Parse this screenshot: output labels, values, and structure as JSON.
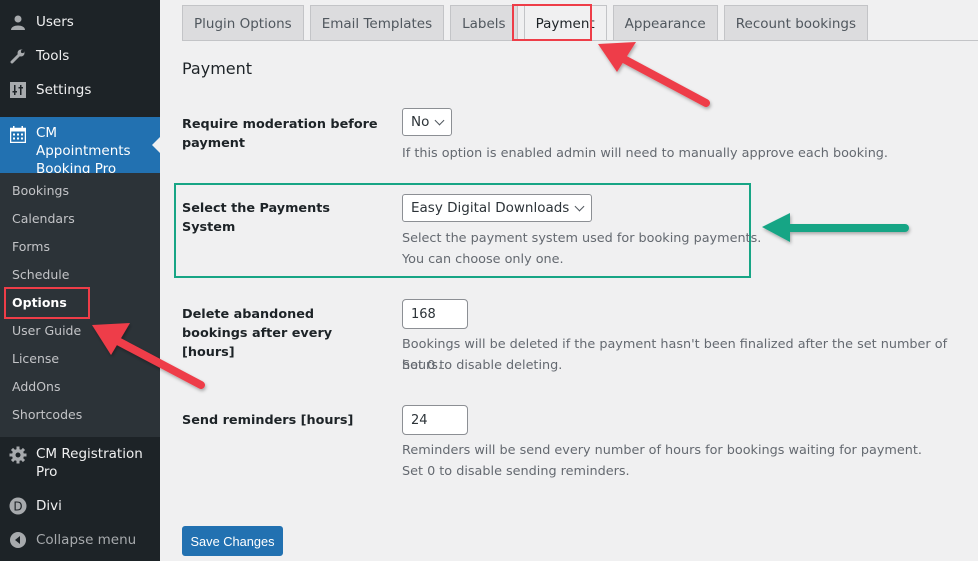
{
  "sidebar": {
    "top_items": [
      {
        "label": "Users",
        "icon": "users-icon"
      },
      {
        "label": "Tools",
        "icon": "wrench-icon"
      },
      {
        "label": "Settings",
        "icon": "settings-sliders-icon"
      }
    ],
    "active_item": {
      "label": "CM Appointments Booking Pro",
      "icon": "calendar-icon"
    },
    "submenu": [
      "Bookings",
      "Calendars",
      "Forms",
      "Schedule",
      "Options",
      "User Guide",
      "License",
      "AddOns",
      "Shortcodes"
    ],
    "current_submenu": "Options",
    "bottom_items": [
      {
        "label": "CM Registration Pro",
        "icon": "gear-icon"
      },
      {
        "label": "Divi",
        "icon": "divi-icon"
      },
      {
        "label": "Collapse menu",
        "icon": "collapse-icon"
      }
    ]
  },
  "tabs": [
    {
      "label": "Plugin Options",
      "active": false
    },
    {
      "label": "Email Templates",
      "active": false
    },
    {
      "label": "Labels",
      "active": false
    },
    {
      "label": "Payment",
      "active": true
    },
    {
      "label": "Appearance",
      "active": false
    },
    {
      "label": "Recount bookings",
      "active": false
    }
  ],
  "section_title": "Payment",
  "fields": {
    "moderation": {
      "label": "Require moderation before payment",
      "value": "No",
      "description": "If this option is enabled admin will need to manually approve each booking."
    },
    "payment_system": {
      "label": "Select the Payments System",
      "value": "Easy Digital Downloads",
      "description_1": "Select the payment system used for booking payments.",
      "description_2": "You can choose only one."
    },
    "delete_abandoned": {
      "label": "Delete abandoned bookings after every [hours]",
      "value": "168",
      "description_1": "Bookings will be deleted if the payment hasn't been finalized after the set number of hours.",
      "description_2": "Set 0 to disable deleting."
    },
    "reminders": {
      "label": "Send reminders [hours]",
      "value": "24",
      "description_1": "Reminders will be send every number of hours for bookings waiting for payment.",
      "description_2": "Set 0 to disable sending reminders."
    }
  },
  "save_label": "Save Changes",
  "annotation_colors": {
    "red": "#ee3d48",
    "green": "#17a585"
  }
}
